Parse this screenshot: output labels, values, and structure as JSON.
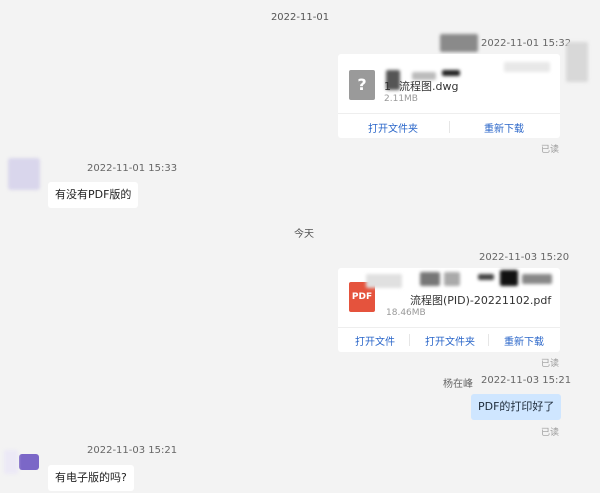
{
  "chat": {
    "date_divider_1": "2022-11-01",
    "date_divider_2": "今天",
    "msg1": {
      "timestamp": "2022-11-01 15:32",
      "file_icon": "?",
      "file_name": "流程图.dwg",
      "file_prefix": "1",
      "file_size": "2.11MB",
      "action_open_folder": "打开文件夹",
      "action_redownload": "重新下载",
      "read": "已读"
    },
    "msg2": {
      "timestamp": "2022-11-01 15:33",
      "text": "有没有PDF版的"
    },
    "msg3": {
      "timestamp": "2022-11-03 15:20",
      "file_icon": "PDF",
      "file_name": "流程图(PID)-20221102.pdf",
      "file_size": "18.46MB",
      "action_open_file": "打开文件",
      "action_open_folder": "打开文件夹",
      "action_redownload": "重新下载",
      "read": "已读"
    },
    "msg4": {
      "sender": "杨在峰",
      "timestamp": "2022-11-03 15:21",
      "text": "PDF的打印好了",
      "read": "已读"
    },
    "msg5": {
      "timestamp": "2022-11-03 15:21",
      "text": "有电子版的吗?"
    }
  },
  "colors": {
    "background": "#f3f3f3",
    "outgoing_bubble": "#cfe6ff",
    "incoming_bubble": "#ffffff",
    "link": "#2a66c9",
    "pdf_icon": "#e5533d"
  }
}
